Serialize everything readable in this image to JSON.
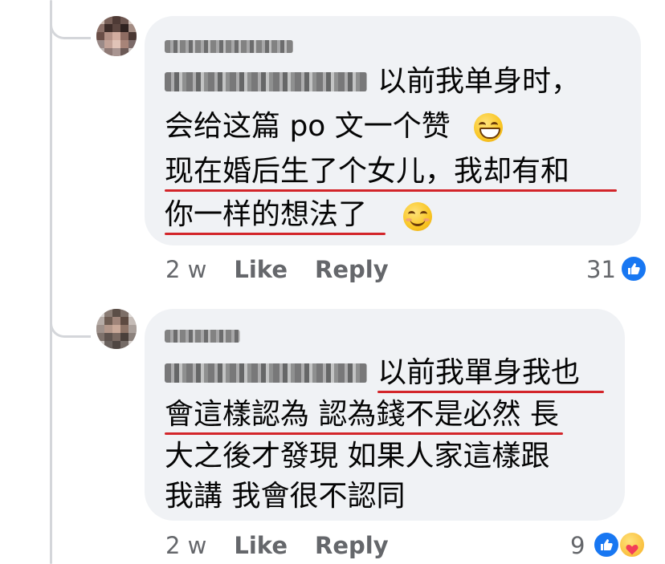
{
  "comments": [
    {
      "author_name": "",
      "mention": "",
      "lines": [
        "以前我单身时，",
        "会给这篇 po 文一个赞",
        "现在婚后生了个女儿，我却有和",
        "你一样的想法了"
      ],
      "emoji_line2": "grinning-face-icon",
      "emoji_line4": "smiling-face-icon",
      "time": "2 w",
      "like_label": "Like",
      "reply_label": "Reply",
      "reaction_count": "31",
      "reaction_icons": [
        "like-icon"
      ]
    },
    {
      "author_name": "",
      "mention": "",
      "lines": [
        "以前我單身我也",
        "會這樣認為 認為錢不是必然 長",
        "大之後才發現 如果人家這樣跟",
        "我講 我會很不認同"
      ],
      "time": "2 w",
      "like_label": "Like",
      "reply_label": "Reply",
      "reaction_count": "9",
      "reaction_icons": [
        "like-icon",
        "care-icon"
      ]
    }
  ],
  "colors": {
    "bubble": "#f0f2f5",
    "text": "#050505",
    "meta": "#65676b",
    "like_blue": "#1877f2",
    "underline_red": "#d3252a",
    "thread_line": "#d4d6da"
  }
}
